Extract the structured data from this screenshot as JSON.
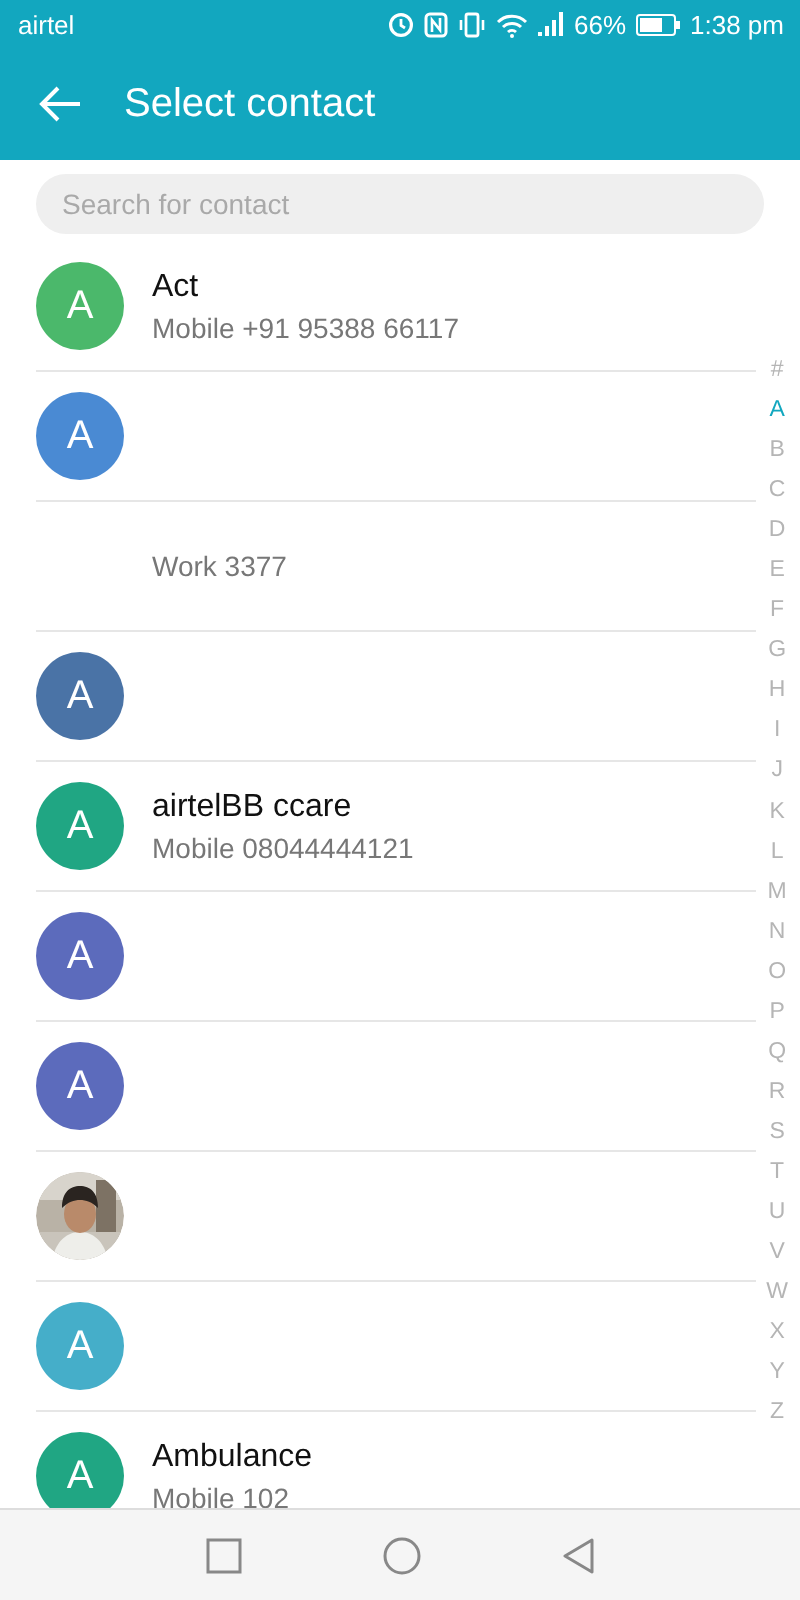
{
  "status_bar": {
    "carrier": "airtel",
    "battery_percent": "66%",
    "time": "1:38 pm"
  },
  "app_bar": {
    "title": "Select contact"
  },
  "search": {
    "placeholder": "Search for contact"
  },
  "contacts": [
    {
      "avatar": {
        "kind": "letter",
        "letter": "A",
        "color": "#4bb86b"
      },
      "name": "Act",
      "detail": "Mobile +91 95388 66117"
    },
    {
      "avatar": {
        "kind": "letter",
        "letter": "A",
        "color": "#4a8ad3"
      }
    },
    {
      "avatar": {
        "kind": "none"
      },
      "detail": "Work 3377"
    },
    {
      "avatar": {
        "kind": "letter",
        "letter": "A",
        "color": "#4a73a6"
      }
    },
    {
      "avatar": {
        "kind": "letter",
        "letter": "A",
        "color": "#20a683"
      },
      "name": "airtelBB ccare",
      "detail": "Mobile 08044444121"
    },
    {
      "avatar": {
        "kind": "letter",
        "letter": "A",
        "color": "#5c6bbc"
      }
    },
    {
      "avatar": {
        "kind": "letter",
        "letter": "A",
        "color": "#5c6bbc"
      }
    },
    {
      "avatar": {
        "kind": "picture"
      }
    },
    {
      "avatar": {
        "kind": "letter",
        "letter": "A",
        "color": "#45aec9"
      }
    },
    {
      "avatar": {
        "kind": "letter",
        "letter": "A",
        "color": "#20a683"
      },
      "name": "Ambulance",
      "detail": "Mobile 102"
    }
  ],
  "index": [
    {
      "label": "#",
      "selected": false
    },
    {
      "label": "A",
      "selected": true
    },
    {
      "label": "B",
      "selected": false
    },
    {
      "label": "C",
      "selected": false
    },
    {
      "label": "D",
      "selected": false
    },
    {
      "label": "E",
      "selected": false
    },
    {
      "label": "F",
      "selected": false
    },
    {
      "label": "G",
      "selected": false
    },
    {
      "label": "H",
      "selected": false
    },
    {
      "label": "I",
      "selected": false
    },
    {
      "label": "J",
      "selected": false
    },
    {
      "label": "K",
      "selected": false
    },
    {
      "label": "L",
      "selected": false
    },
    {
      "label": "M",
      "selected": false
    },
    {
      "label": "N",
      "selected": false
    },
    {
      "label": "O",
      "selected": false
    },
    {
      "label": "P",
      "selected": false
    },
    {
      "label": "Q",
      "selected": false
    },
    {
      "label": "R",
      "selected": false
    },
    {
      "label": "S",
      "selected": false
    },
    {
      "label": "T",
      "selected": false
    },
    {
      "label": "U",
      "selected": false
    },
    {
      "label": "V",
      "selected": false
    },
    {
      "label": "W",
      "selected": false
    },
    {
      "label": "X",
      "selected": false
    },
    {
      "label": "Y",
      "selected": false
    },
    {
      "label": "Z",
      "selected": false
    }
  ]
}
